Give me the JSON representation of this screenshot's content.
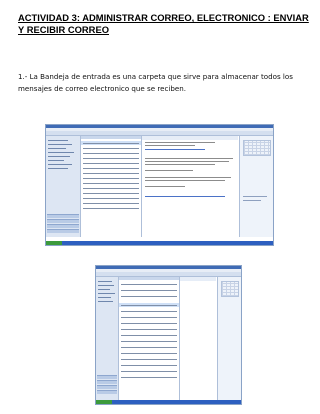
{
  "document": {
    "title": "ACTIVIDAD 3:      ADMINISTRAR CORREO, ELECTRONICO : ENVIAR Y RECIBIR CORREO",
    "paragraph": "1.-  La Bandeja de entrada es una  carpeta que sirve para almacenar todos los mensajes de correo electronico que se reciben."
  },
  "colors": {
    "window_chrome": "#3f6bb5",
    "taskbar": "#2d5fc0",
    "nav_pane": "#dde6f3"
  }
}
